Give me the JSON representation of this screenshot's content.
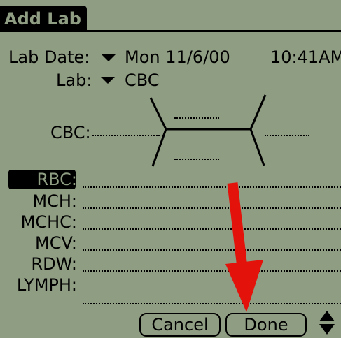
{
  "window": {
    "title": "Add Lab"
  },
  "lab_date": {
    "label": "Lab Date:",
    "date": "Mon 11/6/00",
    "time": "10:41AM"
  },
  "lab": {
    "label": "Lab:",
    "value": "CBC"
  },
  "cbc_diagram": {
    "label": "CBC:"
  },
  "fields": [
    {
      "label": "RBC:",
      "selected": true
    },
    {
      "label": "MCH:"
    },
    {
      "label": "MCHC:"
    },
    {
      "label": "MCV:"
    },
    {
      "label": "RDW:"
    },
    {
      "label": "LYMPH:"
    }
  ],
  "buttons": {
    "cancel": "Cancel",
    "done": "Done"
  },
  "colors": {
    "screen_bg": "#8f9d83",
    "ink": "#000000",
    "arrow": "#e3120b"
  }
}
